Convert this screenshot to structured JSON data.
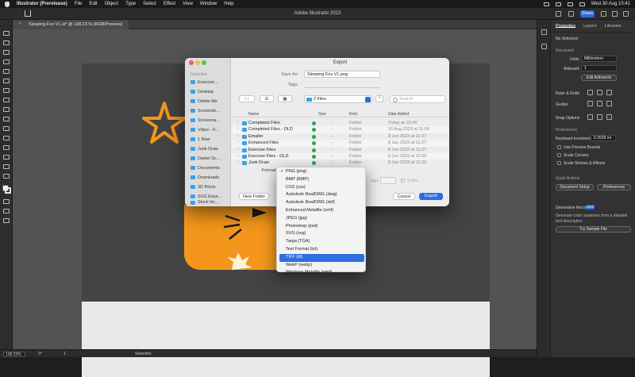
{
  "menubar": {
    "app": "Illustrator (Prerelease)",
    "items": [
      "File",
      "Edit",
      "Object",
      "Type",
      "Select",
      "Effect",
      "View",
      "Window",
      "Help"
    ],
    "clock": "Wed 30 Aug  10:41"
  },
  "titlebar": {
    "title": "Adobe Illustrator 2023",
    "share": "Share"
  },
  "doc_tab": {
    "label": "Sleeping Fox V1.ai* @ 138.23 % (RGB/Preview)",
    "close": "×"
  },
  "status": {
    "zoom": "138.23%",
    "angle": "0°",
    "page": "1",
    "tool": "Selection"
  },
  "panel": {
    "tabs": [
      "Properties",
      "Layers",
      "Libraries"
    ],
    "no_selection": "No Selection",
    "document": "Document",
    "units_label": "Units",
    "units_value": "Millimeters",
    "artboard_label": "Artboard:",
    "artboard_value": "1",
    "edit_artboards": "Edit Artboards",
    "ruler_grids": "Ruler & Grids",
    "guides": "Guides",
    "snap_options": "Snap Options",
    "preferences": "Preferences",
    "keyboard_increment": "Keyboard Increment:",
    "keyboard_value": "0.3528 mr",
    "checks": [
      "Use Preview Bounds",
      "Scale Corners",
      "Scale Strokes & Effects"
    ],
    "quick_actions": "Quick Actions",
    "document_setup": "Document Setup",
    "prefs_btn": "Preferences",
    "gen_recolor": "Generative Recolor",
    "new_badge": "NEW",
    "gen_desc1": "Generate color variations from a detailed",
    "gen_desc2": "text description",
    "try_sample": "Try Sample File"
  },
  "dialog": {
    "title": "Export",
    "favorites_label": "Favorites",
    "favorites": [
      "Exercise...",
      "Desktop",
      "Delete Me",
      "Screensh...",
      "Screenca...",
      "Video - II...",
      "1 Raw",
      "Junk Draw",
      "Daniel Sc...",
      "Documents",
      "Downloads",
      "3D Prints",
      "SVG Expo...",
      "Stock Im..."
    ],
    "save_as_label": "Save As:",
    "save_as_value": "Sleeping Fox V1.png",
    "tags_label": "Tags:",
    "location": "2 Files",
    "search_placeholder": "Search",
    "columns": {
      "name": "Name",
      "size": "Size",
      "kind": "Kind",
      "date": "Date Added"
    },
    "rows": [
      {
        "name": "Completed Files",
        "size": "--",
        "kind": "Folder",
        "date": "Today at 10:34"
      },
      {
        "name": "Completed Files - OLD",
        "size": "--",
        "kind": "Folder",
        "date": "16 Aug 2023 at 11:56"
      },
      {
        "name": "Emailer",
        "size": "--",
        "kind": "Folder",
        "date": "8 Jun 2023 at 11:27"
      },
      {
        "name": "Enhanced Files",
        "size": "--",
        "kind": "Folder",
        "date": "8 Jun 2023 at 11:27"
      },
      {
        "name": "Exercise Files",
        "size": "--",
        "kind": "Folder",
        "date": "8 Jun 2023 at 11:27"
      },
      {
        "name": "Exercise Files - OLD",
        "size": "--",
        "kind": "Folder",
        "date": "8 Jun 2023 at 11:55"
      },
      {
        "name": "Junk Draw",
        "size": "--",
        "kind": "Folder",
        "date": "8 Jun 2023 at 11:29"
      }
    ],
    "format_label": "Format",
    "range_label": "age:",
    "suffix_label": "Suffix",
    "new_folder": "New Folder",
    "cancel": "Cancel",
    "export": "Export"
  },
  "format_menu": {
    "checked": "✓",
    "options": [
      "PNG (png)",
      "BMP (BMP)",
      "CSS (css)",
      "Autodesk RealDWG (dwg)",
      "Autodesk RealDWG (dxf)",
      "Enhanced Metafile (emf)",
      "JPEG (jpg)",
      "Photoshop (psd)",
      "SVG (svg)",
      "Targa (TGA)",
      "Text Format (txt)",
      "TIFF (tif)",
      "WebP (webp)",
      "Windows Metafile (wmf)"
    ],
    "highlighted_index": 11
  },
  "colors": {
    "accent": "#2b6de0",
    "fox_orange": "#f3961b",
    "folder": "#3ea0e6",
    "tag_green": "#2aa64a"
  }
}
